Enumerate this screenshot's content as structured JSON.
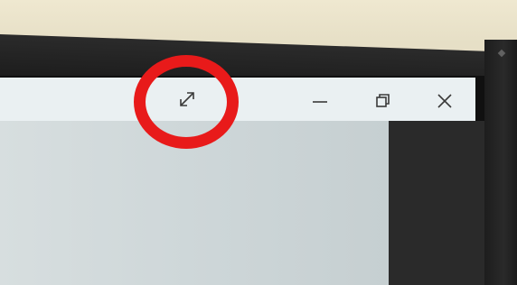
{
  "window": {
    "controls": [
      {
        "name": "fullscreen",
        "icon": "expand-diagonal-icon"
      },
      {
        "name": "minimize",
        "icon": "minimize-icon"
      },
      {
        "name": "restore",
        "icon": "restore-icon"
      },
      {
        "name": "close",
        "icon": "close-icon"
      }
    ]
  },
  "annotation": {
    "color": "#e81a1a",
    "target": "fullscreen-button"
  },
  "colors": {
    "titlebar": "#eaf0f2",
    "bezel": "#1b1b1b",
    "content": "#cdd6d8"
  }
}
